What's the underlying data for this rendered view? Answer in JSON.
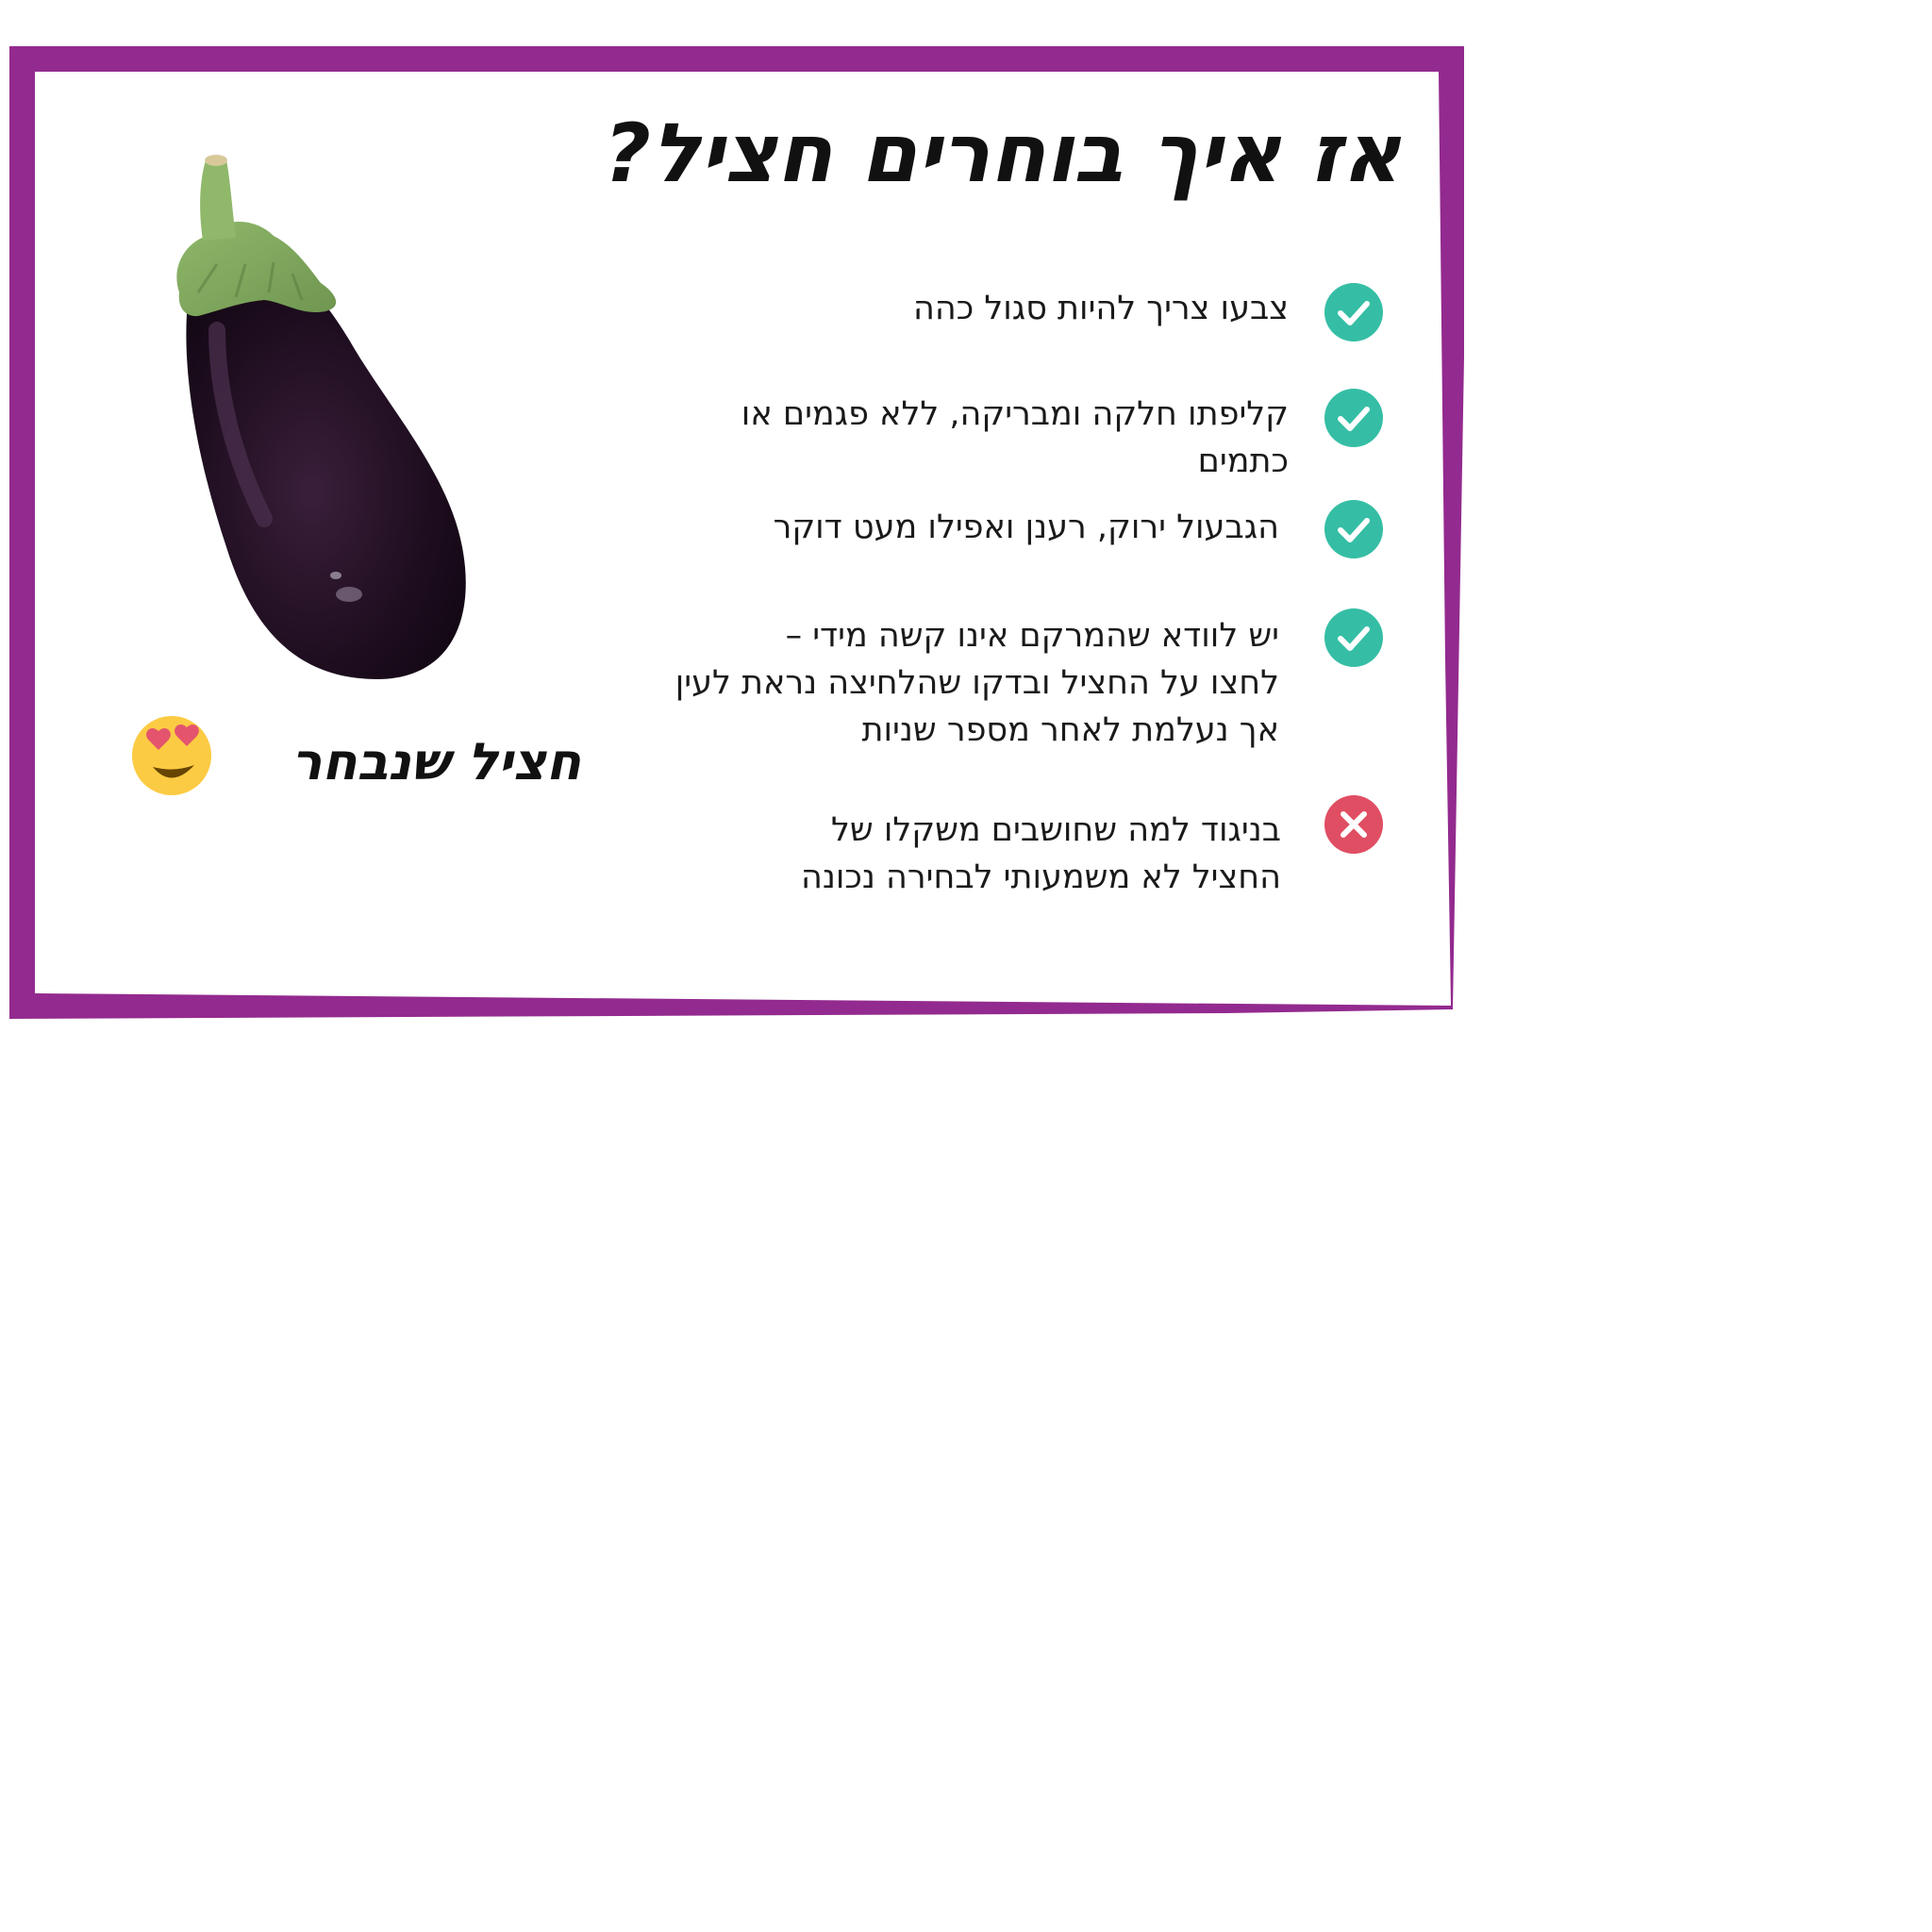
{
  "colors": {
    "frame": "#932a8f",
    "check": "#35bea5",
    "cross": "#e04e63"
  },
  "card": {
    "title": "אז איך בוחרים חציל?",
    "items": [
      {
        "status": "check-icon",
        "lines": [
          "צבעו צריך להיות סגול כהה"
        ]
      },
      {
        "status": "check-icon",
        "lines": [
          "קליפתו חלקה ומבריקה, ללא פגמים או",
          "כתמים"
        ]
      },
      {
        "status": "check-icon",
        "lines": [
          "הגבעול ירוק, רענן ואפילו מעט דוקר"
        ]
      },
      {
        "status": "check-icon",
        "lines": [
          "יש לוודא שהמרקם אינו קשה מידי –",
          "לחצו על החציל ובדקו שהלחיצה נראת לעין",
          "אך נעלמת לאחר מספר שניות"
        ]
      },
      {
        "status": "cross-icon",
        "lines": [
          "בניגוד למה שחושבים משקלו של",
          "החציל לא משמעותי לבחירה נכונה"
        ]
      }
    ],
    "caption": "חציל שנבחר",
    "caption_icon": "heart-eyes-emoji-icon",
    "image_icon": "eggplant-icon"
  }
}
